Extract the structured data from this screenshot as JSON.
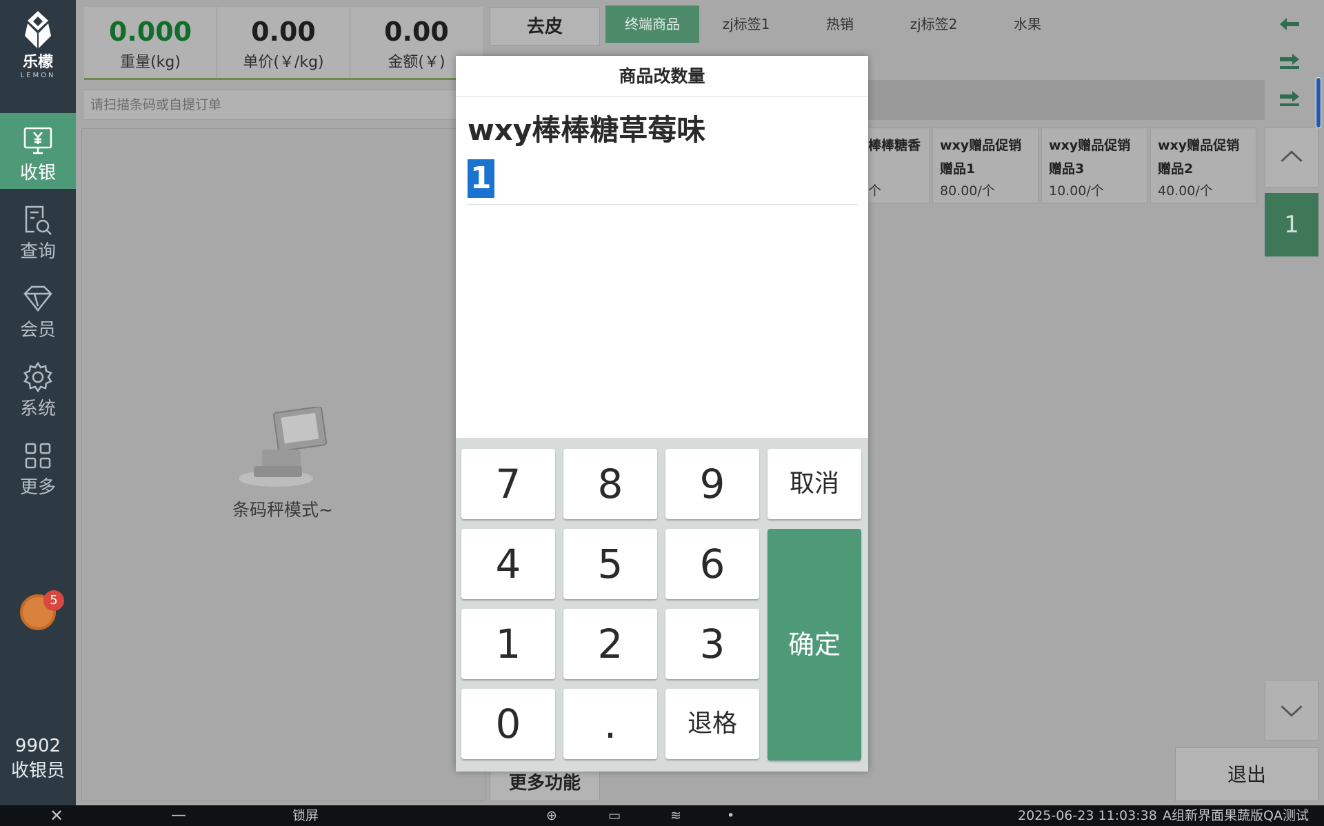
{
  "sidebar": {
    "logo_cn": "乐檬",
    "logo_en": "LEMON",
    "nav": [
      {
        "label": "收银",
        "icon": "cash-register-icon"
      },
      {
        "label": "查询",
        "icon": "search-document-icon"
      },
      {
        "label": "会员",
        "icon": "diamond-icon"
      },
      {
        "label": "系统",
        "icon": "gear-icon"
      },
      {
        "label": "更多",
        "icon": "grid-icon"
      }
    ],
    "notification_count": "5",
    "cashier_id": "9902",
    "cashier_role": "收银员"
  },
  "metrics": {
    "weight_value": "0.000",
    "weight_label": "重量(kg)",
    "unit_price_value": "0.00",
    "unit_price_label": "单价(￥/kg)",
    "amount_value": "0.00",
    "amount_label": "金额(￥)"
  },
  "scan": {
    "placeholder": "请扫描条码或自提订单"
  },
  "cart": {
    "empty_text": "条码秤模式~"
  },
  "buttons": {
    "tare": "去皮",
    "more_functions": "更多功能",
    "exit": "退出"
  },
  "tabs": [
    "终端商品",
    "zj标签1",
    "热销",
    "zj标签2",
    "水果"
  ],
  "products": [
    {
      "name": "棒棒糖香",
      "price": "个"
    },
    {
      "name": "wxy赠品促销赠品1",
      "price": "80.00/个"
    },
    {
      "name": "wxy赠品促销赠品3",
      "price": "10.00/个"
    },
    {
      "name": "wxy赠品促销赠品2",
      "price": "40.00/个"
    }
  ],
  "pager": {
    "page": "1"
  },
  "modal": {
    "title": "商品改数量",
    "product_name": "wxy棒棒糖草莓味",
    "quantity": "1",
    "keys": {
      "k7": "7",
      "k8": "8",
      "k9": "9",
      "cancel": "取消",
      "k4": "4",
      "k5": "5",
      "k6": "6",
      "k1": "1",
      "k2": "2",
      "k3": "3",
      "confirm": "确定",
      "k0": "0",
      "dot": ".",
      "backspace": "退格"
    }
  },
  "taskbar": {
    "lock": "锁屏",
    "datetime": "2025-06-23 11:03:38",
    "store": "A组新界面果蔬版QA测试"
  }
}
